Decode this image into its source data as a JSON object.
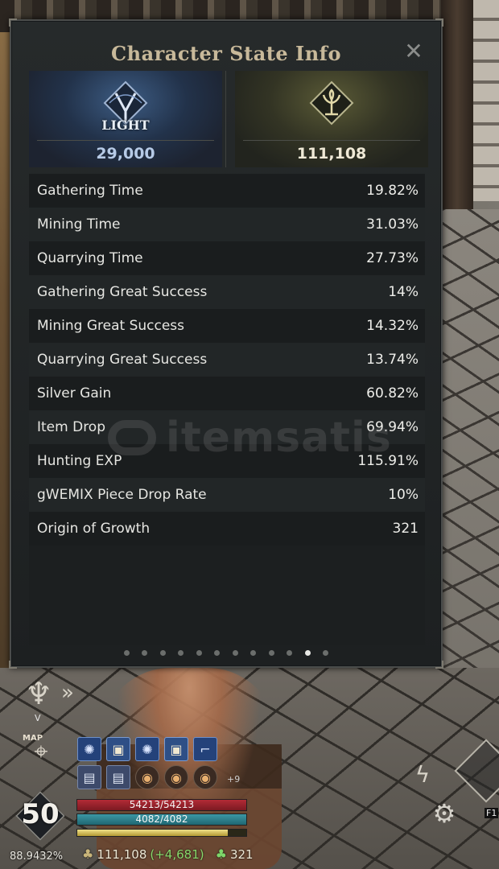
{
  "panel": {
    "title": "Character State Info",
    "light": {
      "label": "LIGHT",
      "value": "29,000",
      "icon": "light-emblem-icon"
    },
    "growth": {
      "value": "111,108",
      "icon": "tree-emblem-icon"
    },
    "rows": [
      {
        "label": "Gathering Time",
        "value": "19.82%"
      },
      {
        "label": "Mining Time",
        "value": "31.03%"
      },
      {
        "label": "Quarrying Time",
        "value": "27.73%"
      },
      {
        "label": "Gathering Great Success",
        "value": "14%"
      },
      {
        "label": "Mining Great Success",
        "value": "14.32%"
      },
      {
        "label": "Quarrying Great Success",
        "value": "13.74%"
      },
      {
        "label": "Silver Gain",
        "value": "60.82%"
      },
      {
        "label": "Item Drop",
        "value": "69.94%"
      },
      {
        "label": "Hunting EXP",
        "value": "115.91%"
      },
      {
        "label": "gWEMIX Piece Drop Rate",
        "value": "10%"
      },
      {
        "label": "Origin of Growth",
        "value": "321"
      }
    ],
    "page_dots": {
      "count": 12,
      "active_index": 10
    }
  },
  "watermark": {
    "text": "itemsatis"
  },
  "hud": {
    "v_key": "V",
    "map_label": "MAP",
    "buffs_more": "+9",
    "level": "50",
    "exp_percent": "88.9432%",
    "hp": {
      "text": "54213/54213",
      "fraction": 1.0
    },
    "mp": {
      "text": "4082/4082",
      "fraction": 1.0
    },
    "exp_fraction": 0.889,
    "growth_currency": "111,108",
    "growth_gain": "(+4,681)",
    "origin_currency": "321",
    "f1_key": "F1"
  },
  "colors": {
    "light_value": "#b6cae6",
    "growth_value": "#efe9d6",
    "hp": "#b22b36",
    "mp": "#3c98a5",
    "gain": "#88d96b"
  }
}
